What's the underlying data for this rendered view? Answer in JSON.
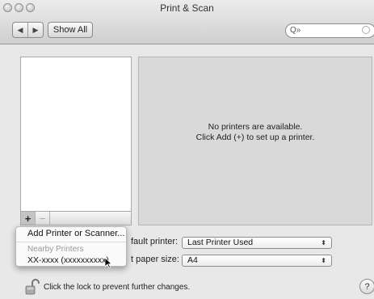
{
  "window": {
    "title": "Print & Scan"
  },
  "toolbar": {
    "back_icon": "◀",
    "forward_icon": "▶",
    "show_all_label": "Show All",
    "search_placeholder": "",
    "search_icon": "Q»"
  },
  "printer_list": {
    "add_label": "+",
    "remove_label": "−"
  },
  "detail": {
    "empty_line1": "No printers are available.",
    "empty_line2": "Click Add (+) to set up a printer."
  },
  "settings": {
    "default_printer_label": "fault printer:",
    "default_printer_value": "Last Printer Used",
    "paper_size_label": "t paper size:",
    "paper_size_value": "A4",
    "popup_arrows": "⬍"
  },
  "add_menu": {
    "add_item": "Add Printer or Scanner...",
    "nearby_header": "Nearby Printers",
    "nearby_printer": "XX-xxxx (xxxxxxxxxx)"
  },
  "footer": {
    "lock_text": "Click the lock to prevent further changes.",
    "help_label": "?"
  }
}
